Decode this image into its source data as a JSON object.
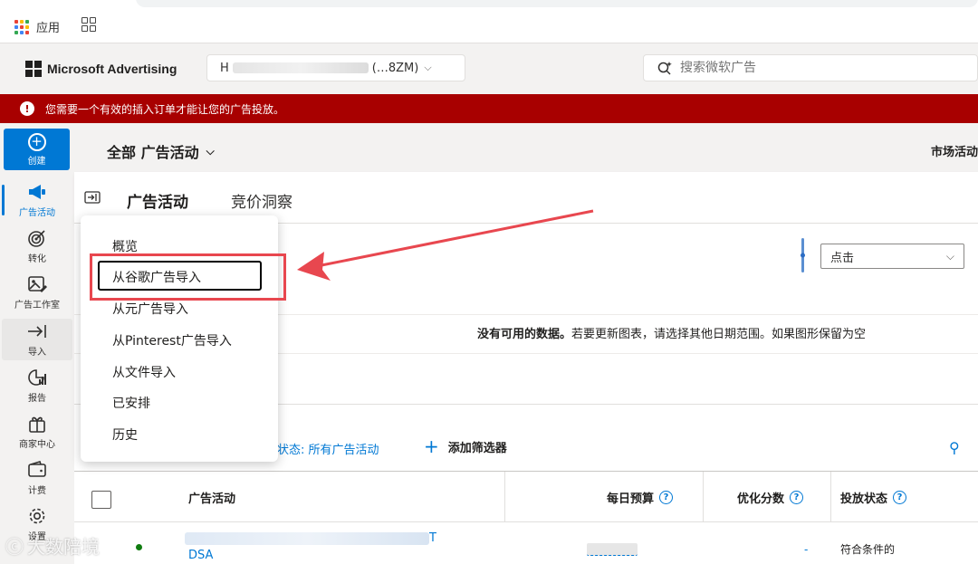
{
  "bookmarks": {
    "apps_label": "应用"
  },
  "header": {
    "brand": "Microsoft Advertising",
    "account_prefix": "H",
    "account_suffix": "(…8ZM)",
    "search_placeholder": "搜索微软广告"
  },
  "alert": {
    "message": "您需要一个有效的插入订单才能让您的广告投放。"
  },
  "leftnav": {
    "create": "创建",
    "items": [
      {
        "label": "广告活动",
        "icon": "megaphone-icon"
      },
      {
        "label": "转化",
        "icon": "target-icon"
      },
      {
        "label": "广告工作室",
        "icon": "image-edit-icon"
      },
      {
        "label": "导入",
        "icon": "import-arrow-icon"
      },
      {
        "label": "报告",
        "icon": "report-chart-icon"
      },
      {
        "label": "商家中心",
        "icon": "gift-icon"
      },
      {
        "label": "计费",
        "icon": "wallet-icon"
      },
      {
        "label": "设置",
        "icon": "gear-icon"
      }
    ]
  },
  "main": {
    "scope": "全部 广告活动",
    "market_label": "市场活动",
    "tabs": [
      "广告活动",
      "竞价洞察"
    ],
    "metric_selected": "点击",
    "no_data_bold": "没有可用的数据。",
    "no_data_rest": "若要更新图表，请选择其他日期范围。如果图形保留为空",
    "filter_status": "状态: 所有广告活动",
    "add_filter": "添加筛选器"
  },
  "grid": {
    "columns": [
      "广告活动",
      "每日预算",
      "优化分数",
      "投放状态"
    ],
    "rows": [
      {
        "name_suffix": "T",
        "name_line2": "DSA",
        "optimization": "-",
        "status": "符合条件的"
      }
    ]
  },
  "menu": {
    "items": [
      "概览",
      "从谷歌广告导入",
      "从元广告导入",
      "从Pinterest广告导入",
      "从文件导入",
      "已安排",
      "历史"
    ],
    "focused_index": 1
  },
  "watermark": "大数陪境",
  "colors": {
    "accent": "#0078d4",
    "alert_bg": "#a80000",
    "annotation": "#e8474f"
  }
}
